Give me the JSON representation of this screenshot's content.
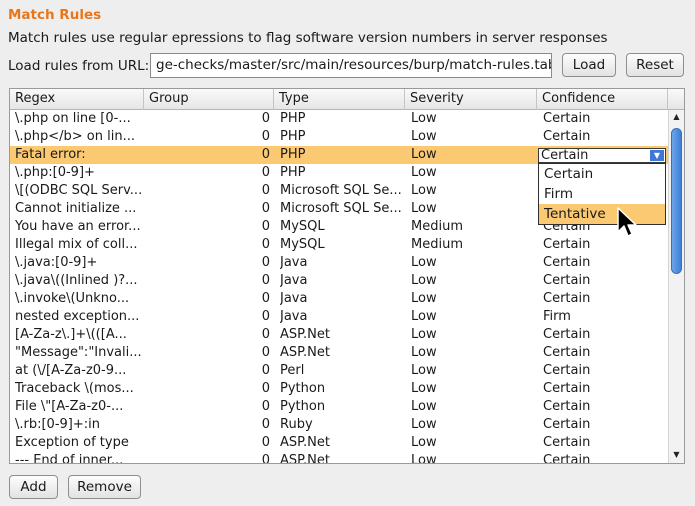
{
  "title": "Match Rules",
  "description": "Match rules use regular epressions to flag software version numbers in server responses",
  "url": {
    "label": "Load rules from URL:",
    "value": "ge-checks/master/src/main/resources/burp/match-rules.tab"
  },
  "buttons": {
    "load": "Load",
    "reset": "Reset",
    "add": "Add",
    "remove": "Remove"
  },
  "table": {
    "columns": [
      "Regex",
      "Group",
      "Type",
      "Severity",
      "Confidence"
    ],
    "rows": [
      {
        "regex": "\\.php on line [0-...",
        "group": "0",
        "type": "PHP",
        "severity": "Low",
        "confidence": "Certain"
      },
      {
        "regex": "\\.php</b> on lin...",
        "group": "0",
        "type": "PHP",
        "severity": "Low",
        "confidence": "Certain"
      },
      {
        "regex": "Fatal error:",
        "group": "0",
        "type": "PHP",
        "severity": "Low",
        "confidence": "Certain"
      },
      {
        "regex": "\\.php:[0-9]+",
        "group": "0",
        "type": "PHP",
        "severity": "Low",
        "confidence": "Certain"
      },
      {
        "regex": "\\[(ODBC SQL Serv...",
        "group": "0",
        "type": "Microsoft SQL Se...",
        "severity": "Low",
        "confidence": "Certain"
      },
      {
        "regex": "Cannot initialize ...",
        "group": "0",
        "type": "Microsoft SQL Se...",
        "severity": "Low",
        "confidence": "Certain"
      },
      {
        "regex": "You have an error...",
        "group": "0",
        "type": "MySQL",
        "severity": "Medium",
        "confidence": "Certain"
      },
      {
        "regex": "Illegal mix of coll...",
        "group": "0",
        "type": "MySQL",
        "severity": "Medium",
        "confidence": "Certain"
      },
      {
        "regex": "\\.java:[0-9]+",
        "group": "0",
        "type": "Java",
        "severity": "Low",
        "confidence": "Certain"
      },
      {
        "regex": "\\.java\\((Inlined )?...",
        "group": "0",
        "type": "Java",
        "severity": "Low",
        "confidence": "Certain"
      },
      {
        "regex": "\\.invoke\\(Unkno...",
        "group": "0",
        "type": "Java",
        "severity": "Low",
        "confidence": "Certain"
      },
      {
        "regex": "nested exception...",
        "group": "0",
        "type": "Java",
        "severity": "Low",
        "confidence": "Firm"
      },
      {
        "regex": "[A-Za-z\\.]+\\(([A...",
        "group": "0",
        "type": "ASP.Net",
        "severity": "Low",
        "confidence": "Certain"
      },
      {
        "regex": "\"Message\":\"Invali...",
        "group": "0",
        "type": "ASP.Net",
        "severity": "Low",
        "confidence": "Certain"
      },
      {
        "regex": "at (\\/[A-Za-z0-9...",
        "group": "0",
        "type": "Perl",
        "severity": "Low",
        "confidence": "Certain"
      },
      {
        "regex": "Traceback \\(mos...",
        "group": "0",
        "type": "Python",
        "severity": "Low",
        "confidence": "Certain"
      },
      {
        "regex": "File \\\"[A-Za-z0-...",
        "group": "0",
        "type": "Python",
        "severity": "Low",
        "confidence": "Certain"
      },
      {
        "regex": "\\.rb:[0-9]+:in",
        "group": "0",
        "type": "Ruby",
        "severity": "Low",
        "confidence": "Certain"
      },
      {
        "regex": "Exception of type",
        "group": "0",
        "type": "ASP.Net",
        "severity": "Low",
        "confidence": "Certain"
      },
      {
        "regex": "--- End of inner...",
        "group": "0",
        "type": "ASP.Net",
        "severity": "Low",
        "confidence": "Certain"
      }
    ],
    "selected_row_index": 2
  },
  "confidence_dropdown": {
    "value": "Certain",
    "options": [
      "Certain",
      "Firm",
      "Tentative"
    ],
    "highlighted_option": "Tentative"
  },
  "colors": {
    "title": "#e8771b",
    "selection": "#fbc972",
    "scroll_thumb": "#3d7fd6"
  },
  "icons": [
    "dropdown-arrow-icon",
    "scroll-up-arrow-icon",
    "scroll-down-arrow-icon",
    "mouse-pointer-icon"
  ]
}
